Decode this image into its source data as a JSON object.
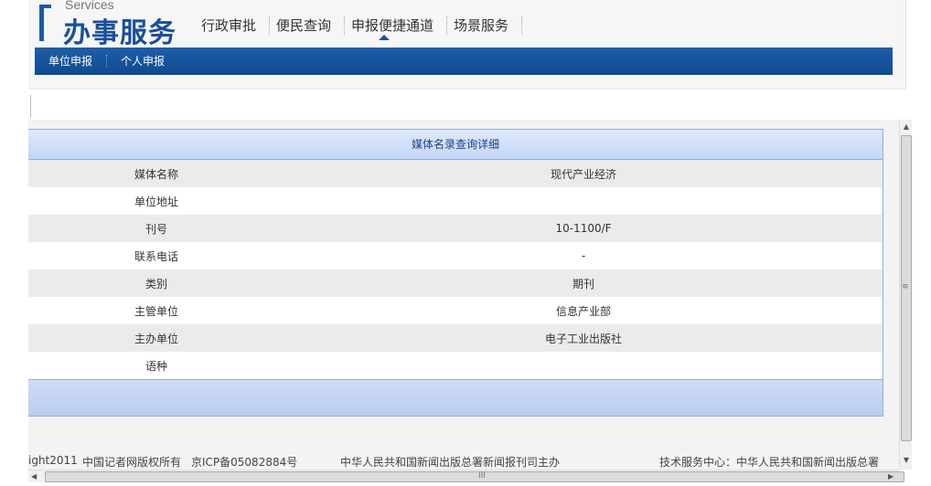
{
  "header": {
    "logo_en": "Services",
    "logo_cn": "办事服务",
    "nav": [
      {
        "label": "行政审批"
      },
      {
        "label": "便民查询"
      },
      {
        "label": "申报便捷通道"
      },
      {
        "label": "场景服务"
      }
    ],
    "subnav": [
      {
        "label": "单位申报"
      },
      {
        "label": "个人申报"
      }
    ]
  },
  "detail": {
    "title": "媒体名录查询详细",
    "rows": [
      {
        "label": "媒体名称",
        "value": "现代产业经济"
      },
      {
        "label": "单位地址",
        "value": ""
      },
      {
        "label": "刊号",
        "value": "10-1100/F"
      },
      {
        "label": "联系电话",
        "value": "-"
      },
      {
        "label": "类别",
        "value": "期刊"
      },
      {
        "label": "主管单位",
        "value": "信息产业部"
      },
      {
        "label": "主办单位",
        "value": "电子工业出版社"
      },
      {
        "label": "语种",
        "value": ""
      }
    ]
  },
  "footer": {
    "copyright": "ight2011",
    "owner": "中国记者网版权所有",
    "icp": "京ICP备05082884号",
    "host": "中华人民共和国新闻出版总署新闻报刊司主办",
    "support": "技术服务中心：中华人民共和国新闻出版总署"
  },
  "icons": {
    "scroll_up": "▲",
    "scroll_down": "▼",
    "scroll_left": "◀",
    "scroll_right": "▶",
    "grip_v": "≡",
    "grip_h": "III"
  }
}
